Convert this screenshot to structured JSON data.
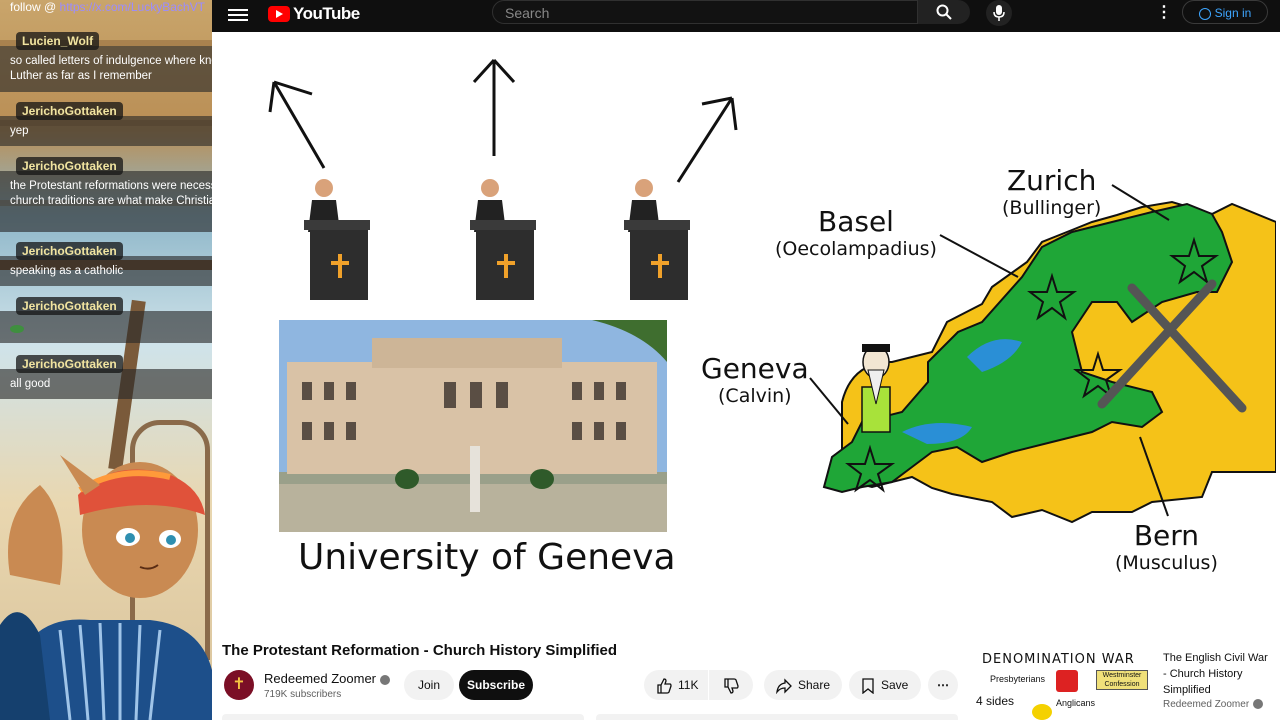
{
  "chat": {
    "follow_prefix": "follow @ ",
    "follow_link": "https://x.com/LuckyBachVT",
    "messages": [
      {
        "user": "Lucien_Wolf",
        "text": "so called letters of indulgence where known to Luther as far as I remember"
      },
      {
        "user": "JerichoGottaken",
        "text": "yep"
      },
      {
        "user": "JerichoGottaken",
        "text": "the Protestant reformations were necessary but church traditions are what make Christianity"
      },
      {
        "user": "JerichoGottaken",
        "text": "speaking as a catholic"
      },
      {
        "user": "JerichoGottaken",
        "text": ""
      },
      {
        "user": "JerichoGottaken",
        "text": "all good"
      }
    ]
  },
  "youtube": {
    "logo_text": "YouTube",
    "search_placeholder": "Search",
    "signin_label": "Sign in"
  },
  "video_frame": {
    "university_caption": "University of Geneva",
    "map": {
      "zurich": {
        "city": "Zurich",
        "person": "(Bullinger)"
      },
      "basel": {
        "city": "Basel",
        "person": "(Oecolampadius)"
      },
      "geneva": {
        "city": "Geneva",
        "person": "(Calvin)"
      },
      "bern": {
        "city": "Bern",
        "person": "(Musculus)"
      }
    },
    "colors": {
      "green": "#1fa637",
      "yellow": "#f5c218",
      "lake": "#2a8fd6"
    }
  },
  "video_info": {
    "title": "The Protestant Reformation - Church History Simplified",
    "channel_name": "Redeemed Zoomer",
    "subscribers": "719K subscribers",
    "join_label": "Join",
    "subscribe_label": "Subscribe",
    "likes": "11K",
    "share_label": "Share",
    "save_label": "Save"
  },
  "recommended": {
    "thumb_title": "DENOMINATION WAR",
    "thumb_sides": "4 sides",
    "thumb_labels": [
      "Presbyterians",
      "Westminster Confession",
      "Anglicans"
    ],
    "title": "The English Civil War - Church History Simplified",
    "channel": "Redeemed Zoomer"
  }
}
